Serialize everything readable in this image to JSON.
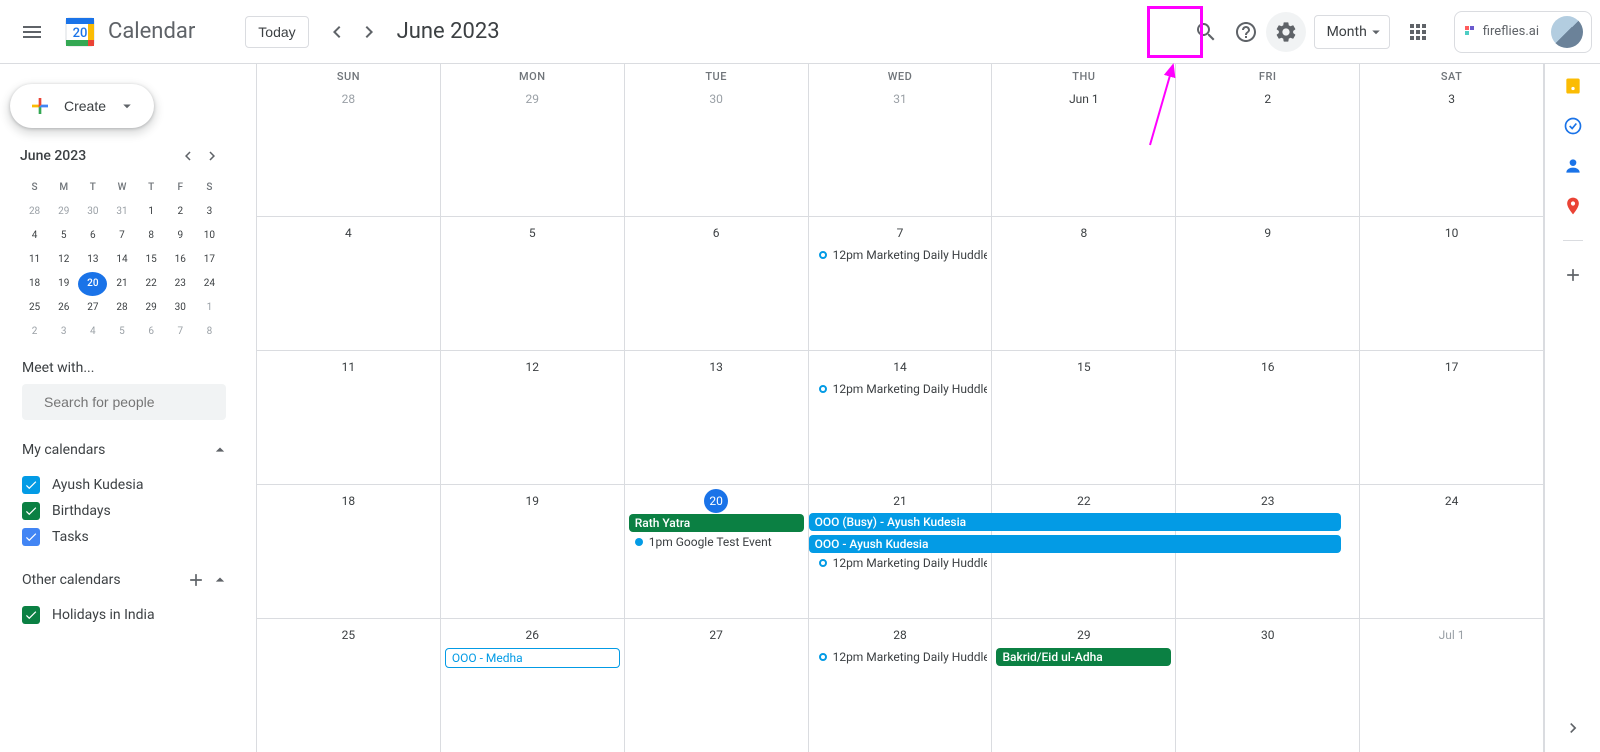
{
  "header": {
    "app_title": "Calendar",
    "today_label": "Today",
    "month_title": "June 2023",
    "view_label": "Month",
    "extension_label": "fireflies.ai",
    "logo_day": "20"
  },
  "sidebar": {
    "create_label": "Create",
    "mini": {
      "title": "June 2023",
      "dow": [
        "S",
        "M",
        "T",
        "W",
        "T",
        "F",
        "S"
      ],
      "rows": [
        [
          {
            "n": "28",
            "o": true
          },
          {
            "n": "29",
            "o": true
          },
          {
            "n": "30",
            "o": true
          },
          {
            "n": "31",
            "o": true
          },
          {
            "n": "1"
          },
          {
            "n": "2"
          },
          {
            "n": "3"
          }
        ],
        [
          {
            "n": "4"
          },
          {
            "n": "5"
          },
          {
            "n": "6"
          },
          {
            "n": "7"
          },
          {
            "n": "8"
          },
          {
            "n": "9"
          },
          {
            "n": "10"
          }
        ],
        [
          {
            "n": "11"
          },
          {
            "n": "12"
          },
          {
            "n": "13"
          },
          {
            "n": "14"
          },
          {
            "n": "15"
          },
          {
            "n": "16"
          },
          {
            "n": "17"
          }
        ],
        [
          {
            "n": "18"
          },
          {
            "n": "19"
          },
          {
            "n": "20",
            "today": true
          },
          {
            "n": "21"
          },
          {
            "n": "22"
          },
          {
            "n": "23"
          },
          {
            "n": "24"
          }
        ],
        [
          {
            "n": "25"
          },
          {
            "n": "26"
          },
          {
            "n": "27"
          },
          {
            "n": "28"
          },
          {
            "n": "29"
          },
          {
            "n": "30"
          },
          {
            "n": "1",
            "o": true
          }
        ],
        [
          {
            "n": "2",
            "o": true
          },
          {
            "n": "3",
            "o": true
          },
          {
            "n": "4",
            "o": true
          },
          {
            "n": "5",
            "o": true
          },
          {
            "n": "6",
            "o": true
          },
          {
            "n": "7",
            "o": true
          },
          {
            "n": "8",
            "o": true
          }
        ]
      ]
    },
    "meet_with_label": "Meet with...",
    "search_placeholder": "Search for people",
    "my_calendars_label": "My calendars",
    "my_calendars": [
      {
        "label": "Ayush Kudesia",
        "color": "#039be5"
      },
      {
        "label": "Birthdays",
        "color": "#0b8043"
      },
      {
        "label": "Tasks",
        "color": "#4285f4"
      }
    ],
    "other_calendars_label": "Other calendars",
    "other_calendars": [
      {
        "label": "Holidays in India",
        "color": "#0b8043"
      }
    ]
  },
  "grid": {
    "dow": [
      "SUN",
      "MON",
      "TUE",
      "WED",
      "THU",
      "FRI",
      "SAT"
    ],
    "weeks": [
      {
        "days": [
          {
            "n": "28",
            "o": true
          },
          {
            "n": "29",
            "o": true
          },
          {
            "n": "30",
            "o": true
          },
          {
            "n": "31",
            "o": true
          },
          {
            "n": "Jun 1"
          },
          {
            "n": "2"
          },
          {
            "n": "3"
          }
        ],
        "events": []
      },
      {
        "days": [
          {
            "n": "4"
          },
          {
            "n": "5"
          },
          {
            "n": "6"
          },
          {
            "n": "7"
          },
          {
            "n": "8"
          },
          {
            "n": "9"
          },
          {
            "n": "10"
          }
        ],
        "events": [
          {
            "col": 3,
            "type": "dot",
            "hollow": true,
            "color": "#039be5",
            "time": "12pm",
            "title": "Marketing Daily Huddle"
          }
        ]
      },
      {
        "days": [
          {
            "n": "11"
          },
          {
            "n": "12"
          },
          {
            "n": "13"
          },
          {
            "n": "14"
          },
          {
            "n": "15"
          },
          {
            "n": "16"
          },
          {
            "n": "17"
          }
        ],
        "events": [
          {
            "col": 3,
            "type": "dot",
            "hollow": true,
            "color": "#039be5",
            "time": "12pm",
            "title": "Marketing Daily Huddle"
          }
        ]
      },
      {
        "days": [
          {
            "n": "18"
          },
          {
            "n": "19"
          },
          {
            "n": "20",
            "today": true
          },
          {
            "n": "21"
          },
          {
            "n": "22"
          },
          {
            "n": "23"
          },
          {
            "n": "24"
          }
        ],
        "events": [
          {
            "col": 2,
            "type": "solid",
            "color": "#0b8043",
            "title": "Rath Yatra"
          },
          {
            "col": 2,
            "type": "dot",
            "color": "#039be5",
            "time": "1pm",
            "title": "Google Test Event"
          },
          {
            "type": "span",
            "startCol": 3,
            "endCol": 5,
            "row": 0,
            "color": "#039be5",
            "title": "OOO (Busy) - Ayush Kudesia"
          },
          {
            "type": "span",
            "startCol": 3,
            "endCol": 5,
            "row": 1,
            "color": "#039be5",
            "title": "OOO - Ayush Kudesia"
          },
          {
            "col": 3,
            "type": "dot",
            "hollow": true,
            "color": "#039be5",
            "time": "12pm",
            "title": "Marketing Daily Huddle",
            "pushdown": 2
          }
        ]
      },
      {
        "days": [
          {
            "n": "25"
          },
          {
            "n": "26"
          },
          {
            "n": "27"
          },
          {
            "n": "28"
          },
          {
            "n": "29"
          },
          {
            "n": "30"
          },
          {
            "n": "Jul 1",
            "o": true
          }
        ],
        "events": [
          {
            "col": 1,
            "type": "outline",
            "color": "#039be5",
            "title": "OOO - Medha"
          },
          {
            "col": 3,
            "type": "dot",
            "hollow": true,
            "color": "#039be5",
            "time": "12pm",
            "title": "Marketing Daily Huddle"
          },
          {
            "col": 4,
            "type": "solid",
            "color": "#0b8043",
            "title": "Bakrid/Eid ul-Adha"
          }
        ]
      }
    ]
  }
}
